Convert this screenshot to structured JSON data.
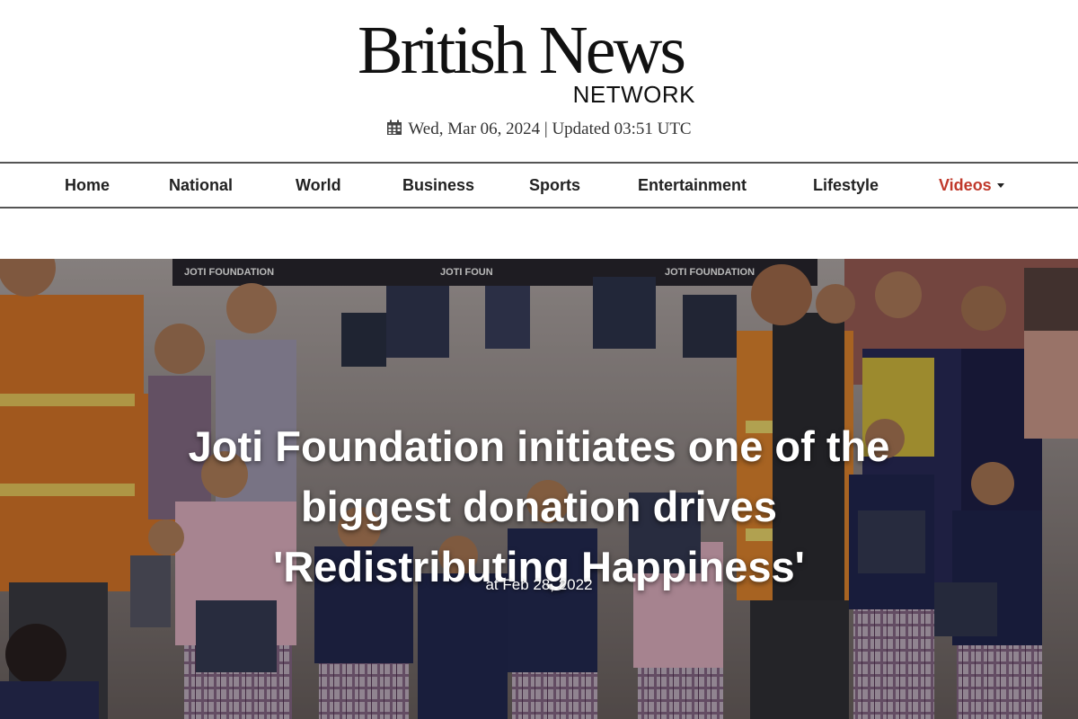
{
  "site": {
    "logo_main": "British News",
    "logo_sub": "NETWORK",
    "date": "Wed, Mar 06, 2024",
    "updated": "Updated 03:51 UTC"
  },
  "nav": {
    "items": [
      {
        "label": "Home"
      },
      {
        "label": "National"
      },
      {
        "label": "World"
      },
      {
        "label": "Business"
      },
      {
        "label": "Sports"
      },
      {
        "label": "Entertainment"
      },
      {
        "label": "Lifestyle"
      },
      {
        "label": "Videos",
        "has_dropdown": true,
        "color": "#c0392b"
      }
    ]
  },
  "hero": {
    "title_line1": "Joti Foundation initiates one of the",
    "title_line2": "biggest donation drives",
    "title_line3": "'Redistributing Happiness'",
    "date": "at Feb 28, 2022",
    "banner_text_1": "JOTI FOUNDATION",
    "banner_text_2": "JOTI FOUN",
    "banner_text_3": "JOTI FOUNDATION"
  },
  "icons": {
    "calendar": "calendar-icon",
    "dropdown": "caret-down-icon"
  }
}
